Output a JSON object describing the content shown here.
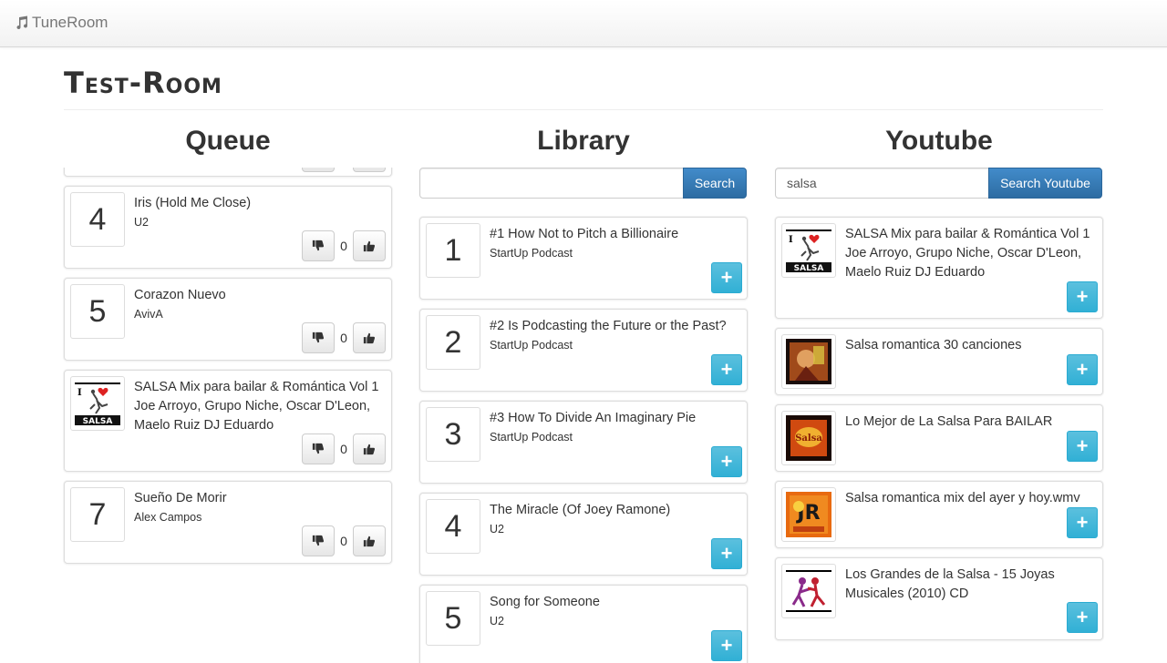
{
  "navbar": {
    "brand": "TuneRoom",
    "brand_icon": "music-note-icon"
  },
  "room": {
    "title": "Test-Room"
  },
  "headings": {
    "queue": "Queue",
    "library": "Library",
    "youtube": "Youtube"
  },
  "queue": {
    "items": [
      {
        "num": "4",
        "title": "Iris (Hold Me Close)",
        "artist": "U2",
        "votes": "0"
      },
      {
        "num": "5",
        "title": "Corazon Nuevo",
        "artist": "AvivA",
        "votes": "0"
      },
      {
        "thumbnail": "salsa-album-thumbnail",
        "title": "SALSA Mix para bailar & Romántica Vol 1 Joe Arroyo, Grupo Niche, Oscar D'Leon, Maelo Ruiz DJ Eduardo",
        "votes": "0"
      },
      {
        "num": "7",
        "title": "Sueño De Morir",
        "artist": "Alex Campos",
        "votes": "0"
      }
    ]
  },
  "library": {
    "search": {
      "value": "",
      "placeholder": "",
      "button": "Search"
    },
    "items": [
      {
        "num": "1",
        "title": "#1 How Not to Pitch a Billionaire",
        "artist": "StartUp Podcast"
      },
      {
        "num": "2",
        "title": "#2 Is Podcasting the Future or the Past?",
        "artist": "StartUp Podcast"
      },
      {
        "num": "3",
        "title": "#3 How To Divide An Imaginary Pie",
        "artist": "StartUp Podcast"
      },
      {
        "num": "4",
        "title": "The Miracle (Of Joey Ramone)",
        "artist": "U2"
      },
      {
        "num": "5",
        "title": "Song for Someone",
        "artist": "U2"
      }
    ]
  },
  "youtube": {
    "search": {
      "value": "salsa",
      "button": "Search Youtube"
    },
    "items": [
      {
        "title": "SALSA Mix para bailar & Romántica Vol 1 Joe Arroyo, Grupo Niche, Oscar D'Leon, Maelo Ruiz DJ Eduardo"
      },
      {
        "title": "Salsa romantica 30 canciones"
      },
      {
        "title": "Lo Mejor de La Salsa Para BAILAR"
      },
      {
        "title": "Salsa romantica mix del ayer y hoy.wmv"
      },
      {
        "title": "Los Grandes de la Salsa - 15 Joyas Musicales (2010) CD"
      }
    ]
  },
  "colors": {
    "primary": "#428bca",
    "info": "#5bc0de",
    "text": "#333333",
    "border": "#dddddd"
  },
  "icons": {
    "downvote": "thumbs-down-icon",
    "upvote": "thumbs-up-icon",
    "add": "plus-icon"
  }
}
